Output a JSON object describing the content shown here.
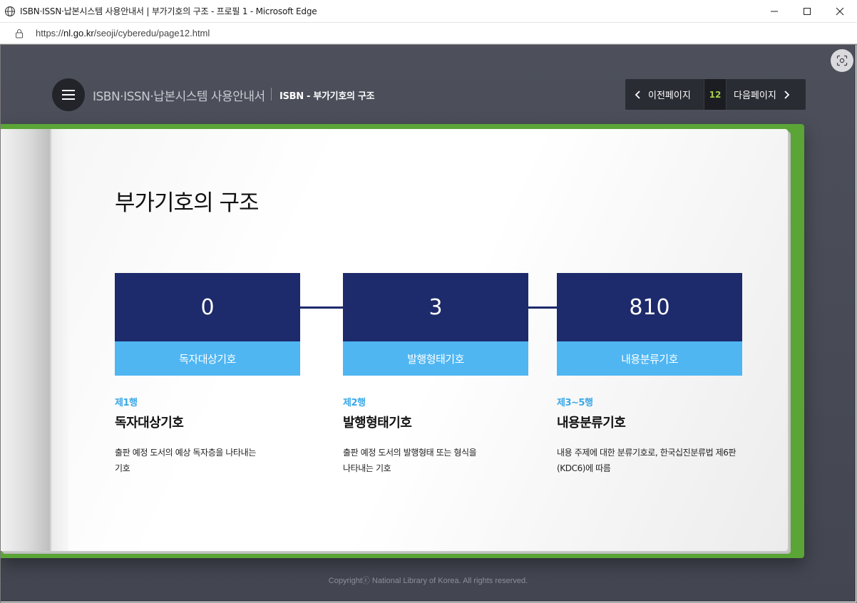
{
  "window": {
    "title": "ISBN·ISSN·납본시스템 사용안내서 | 부가기호의 구조 - 프로필 1 - Microsoft Edge"
  },
  "address": {
    "prefix": "https://",
    "host": "nl.go.kr",
    "path": "/seoji/cyberedu/page12.html"
  },
  "header": {
    "site_title": "ISBN·ISSN·납본시스템 사용안내서",
    "section_title": "ISBN - 부가기호의 구조"
  },
  "pager": {
    "prev_label": "이전페이지",
    "page_number": "12",
    "next_label": "다음페이지",
    "accent_color": "#a6cf48"
  },
  "page": {
    "heading": "부가기호의 구조",
    "codes": [
      {
        "value": "0",
        "label": "독자대상기호",
        "row": "제1행",
        "name": "독자대상기호",
        "desc_line1": "출판 예정 도서의 예상 독자층을 나타내는",
        "desc_line2": "기호"
      },
      {
        "value": "3",
        "label": "발행형태기호",
        "row": "제2행",
        "name": "발행형태기호",
        "desc_line1": "출판 예정 도서의 발행형태 또는 형식을",
        "desc_line2": "나타내는 기호"
      },
      {
        "value": "810",
        "label": "내용분류기호",
        "row": "제3~5행",
        "name": "내용분류기호",
        "desc_line1": "내용 주제에 대한 분류기호로, 한국십진분류법 제6판",
        "desc_line2": "(KDC6)에 따름"
      }
    ],
    "colors": {
      "code_top": "#1d2a6b",
      "code_bottom": "#4fb6f2",
      "row_tag": "#3aa8e8",
      "book_cover": "#5aa536"
    }
  },
  "footer": {
    "copyright": "Copyrightⓒ National Library of Korea. All rights reserved."
  },
  "icons": [
    "globe-icon",
    "minimize-icon",
    "maximize-icon",
    "close-icon",
    "lock-icon",
    "screenshot-icon",
    "menu-icon",
    "chevron-left-icon",
    "chevron-right-icon"
  ]
}
